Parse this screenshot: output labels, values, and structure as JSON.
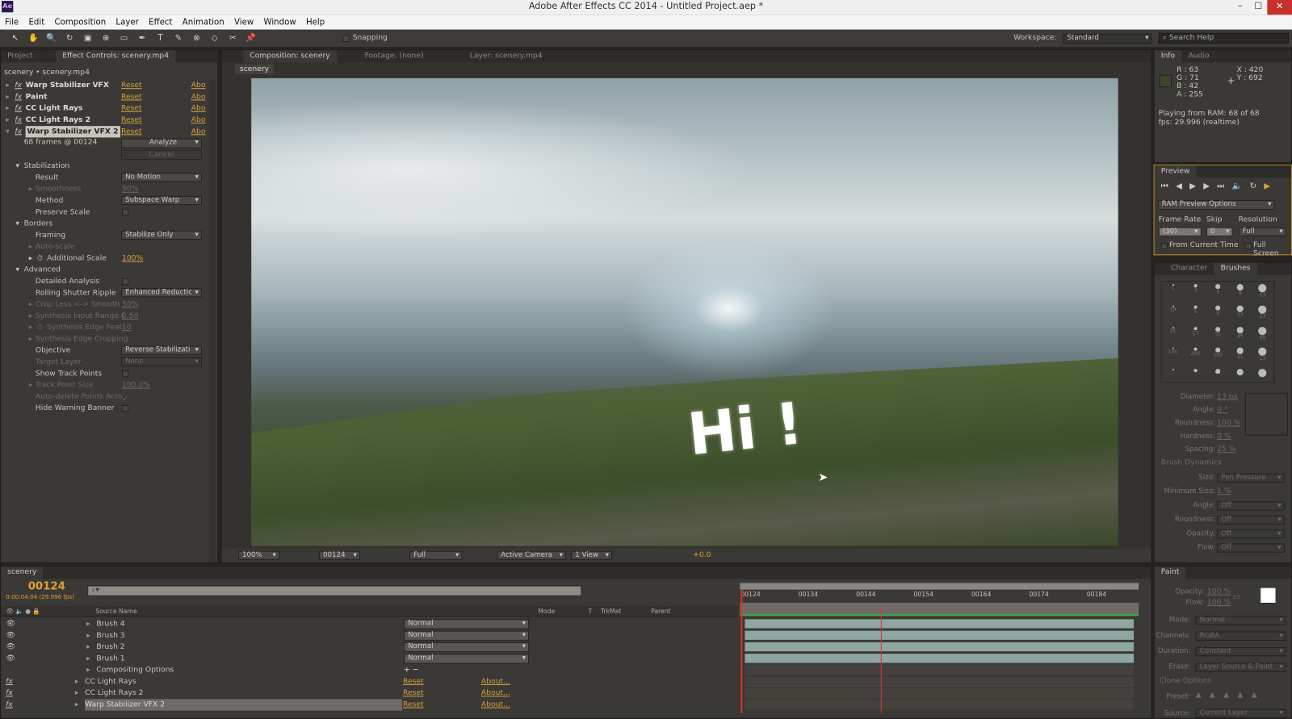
{
  "window": {
    "title": "Adobe After Effects CC 2014 - Untitled Project.aep *",
    "app_icon": "Ae"
  },
  "menu": [
    "File",
    "Edit",
    "Composition",
    "Layer",
    "Effect",
    "Animation",
    "View",
    "Window",
    "Help"
  ],
  "toolbar": {
    "snapping": "Snapping",
    "workspace_label": "Workspace:",
    "workspace_value": "Standard",
    "search_placeholder": "Search Help"
  },
  "left_panel": {
    "tabs": [
      "Project",
      "Effect Controls: scenery.mp4"
    ],
    "breadcrumb": "scenery • scenery.mp4",
    "effects": [
      {
        "name": "Warp Stabilizer VFX",
        "reset": "Reset",
        "about": "Abo"
      },
      {
        "name": "Paint",
        "reset": "Reset",
        "about": "Abo"
      },
      {
        "name": "CC Light Rays",
        "reset": "Reset",
        "about": "Abo"
      },
      {
        "name": "CC Light Rays 2",
        "reset": "Reset",
        "about": "Abo"
      },
      {
        "name": "Warp Stabilizer VFX 2",
        "reset": "Reset",
        "about": "Abo"
      }
    ],
    "status": "68 frames @ 00124",
    "analyze": "Analyze",
    "cancel": "Cancel",
    "props": [
      {
        "label": "Stabilization",
        "level": 1,
        "group": true
      },
      {
        "label": "Result",
        "level": 2,
        "dropdown": "No Motion"
      },
      {
        "label": "Smoothness",
        "level": 2,
        "dim": true,
        "value": "50%",
        "twirl": true
      },
      {
        "label": "Method",
        "level": 2,
        "dropdown": "Subspace Warp"
      },
      {
        "label": "Preserve Scale",
        "level": 2,
        "checkbox": false
      },
      {
        "label": "Borders",
        "level": 1,
        "group": true
      },
      {
        "label": "Framing",
        "level": 2,
        "dropdown": "Stabilize Only"
      },
      {
        "label": "Auto-scale",
        "level": 2,
        "dim": true,
        "twirl": true
      },
      {
        "label": "Additional Scale",
        "level": 2,
        "value": "100%",
        "accent": true,
        "twirl": true,
        "stopwatch": true
      },
      {
        "label": "Advanced",
        "level": 1,
        "group": true
      },
      {
        "label": "Detailed Analysis",
        "level": 2,
        "checkbox": false
      },
      {
        "label": "Rolling Shutter Ripple",
        "level": 2,
        "dropdown": "Enhanced Reductic"
      },
      {
        "label": "Crop Less <-> Smooth",
        "level": 2,
        "dim": true,
        "value": "50%",
        "twirl": true
      },
      {
        "label": "Synthesis Input Range (",
        "level": 2,
        "dim": true,
        "value": "0.50",
        "twirl": true
      },
      {
        "label": "Synthesis Edge Feat",
        "level": 2,
        "dim": true,
        "value": "10",
        "twirl": true,
        "stopwatch": true
      },
      {
        "label": "Synthesis Edge Cropping",
        "level": 2,
        "dim": true,
        "twirl": true
      },
      {
        "label": "Objective",
        "level": 2,
        "dropdown": "Reverse Stabilizati"
      },
      {
        "label": "Target Layer",
        "level": 2,
        "dim": true,
        "dropdown": "None"
      },
      {
        "label": "Show Track Points",
        "level": 2,
        "checkbox": false
      },
      {
        "label": "Track Point Size",
        "level": 2,
        "dim": true,
        "value": "100.0%",
        "twirl": true
      },
      {
        "label": "Auto-delete Points Acro",
        "level": 2,
        "dim": true,
        "checkbox": true
      },
      {
        "label": "Hide Warning Banner",
        "level": 2,
        "checkbox": false
      }
    ]
  },
  "comp_panel": {
    "tabs": [
      "Composition: scenery",
      "Footage: (none)",
      "Layer: scenery.mp4"
    ],
    "sub_tab": "scenery",
    "overlay_text": "Hi !",
    "footer": {
      "zoom": "100%",
      "timecode": "00124",
      "resolution": "Full",
      "camera": "Active Camera",
      "views": "1 View",
      "exposure": "+0.0"
    }
  },
  "info_panel": {
    "tabs": [
      "Info",
      "Audio"
    ],
    "r": "R : 63",
    "g": "G : 71",
    "b": "B : 42",
    "a": "A : 255",
    "x": "X : 420",
    "y": "Y : 692",
    "swatch": "#3f472a",
    "line1": "Playing from RAM: 68 of 68",
    "line2": "fps: 29.996 (realtime)"
  },
  "preview_panel": {
    "tab": "Preview",
    "options": "RAM Preview Options",
    "frame_rate_label": "Frame Rate",
    "frame_rate": "(30)",
    "skip_label": "Skip",
    "skip": "0",
    "resolution_label": "Resolution",
    "resolution": "Full",
    "from_current": "From Current Time",
    "full_screen": "Full Screen"
  },
  "brushes_panel": {
    "tabs": [
      "Character",
      "Brushes"
    ],
    "sizes": [
      "1",
      "3",
      "5",
      "9",
      "13",
      "19",
      "5",
      "9",
      "13",
      "17",
      "21",
      "27",
      "35",
      "45",
      "65",
      "100",
      "200",
      "300",
      "11",
      "13",
      "",
      "",
      "",
      "",
      ""
    ],
    "props": [
      {
        "label": "Diameter:",
        "value": "13 px"
      },
      {
        "label": "Angle:",
        "value": "0 °"
      },
      {
        "label": "Roundness:",
        "value": "100 %"
      },
      {
        "label": "Hardness:",
        "value": "0 %"
      },
      {
        "label": "Spacing:",
        "value": "25 %"
      }
    ],
    "dynamics_title": "Brush Dynamics",
    "dynamics": [
      {
        "label": "Size:",
        "value": "Pen Pressure"
      },
      {
        "label": "Minimum Size:",
        "value": "1 %",
        "text": true
      },
      {
        "label": "Angle:",
        "value": "Off"
      },
      {
        "label": "Roundness:",
        "value": "Off"
      },
      {
        "label": "Opacity:",
        "value": "Off"
      },
      {
        "label": "Flow:",
        "value": "Off"
      }
    ]
  },
  "paint_panel": {
    "tab": "Paint",
    "opacity_label": "Opacity:",
    "opacity": "100 %",
    "flow_label": "Flow:",
    "flow": "100 %",
    "brush_size": "13",
    "props": [
      {
        "label": "Mode:",
        "value": "Normal"
      },
      {
        "label": "Channels:",
        "value": "RGBA"
      },
      {
        "label": "Duration:",
        "value": "Constant"
      },
      {
        "label": "Erase:",
        "value": "Layer Source & Paint"
      }
    ],
    "clone_title": "Clone Options",
    "preset_label": "Preset:",
    "source_label": "Source:",
    "source": "Current Layer"
  },
  "timeline": {
    "tab": "scenery",
    "timecode": "00124",
    "timecode_sub": "0:00:04:04 (29.996 fps)",
    "search_placeholder": "",
    "columns": {
      "source": "Source Name",
      "mode": "Mode",
      "t": "T",
      "trkmat": "TrkMat",
      "parent": "Parent"
    },
    "ruler": [
      "00124",
      "00134",
      "00144",
      "00154",
      "00164",
      "00174",
      "00184"
    ],
    "layers": [
      {
        "name": "Brush 4",
        "indent": 2,
        "mode": "Normal",
        "eye": true,
        "bar": true
      },
      {
        "name": "Brush 3",
        "indent": 2,
        "mode": "Normal",
        "eye": true,
        "bar": true
      },
      {
        "name": "Brush 2",
        "indent": 2,
        "mode": "Normal",
        "eye": true,
        "bar": true
      },
      {
        "name": "Brush 1",
        "indent": 2,
        "mode": "Normal",
        "eye": true,
        "bar": true
      },
      {
        "name": "Compositing Options",
        "indent": 2,
        "plusminus": "+ −"
      },
      {
        "name": "CC Light Rays",
        "indent": 1,
        "fx": true,
        "reset": "Reset",
        "about": "About..."
      },
      {
        "name": "CC Light Rays 2",
        "indent": 1,
        "fx": true,
        "reset": "Reset",
        "about": "About..."
      },
      {
        "name": "Warp Stabilizer VFX 2",
        "indent": 1,
        "fx": true,
        "reset": "Reset",
        "about": "About...",
        "selected": true
      }
    ]
  },
  "colors": {
    "accent": "#d4a23a",
    "panel": "#3b3936",
    "bar": "#8ea7a2",
    "playhead": "#e0302a"
  }
}
